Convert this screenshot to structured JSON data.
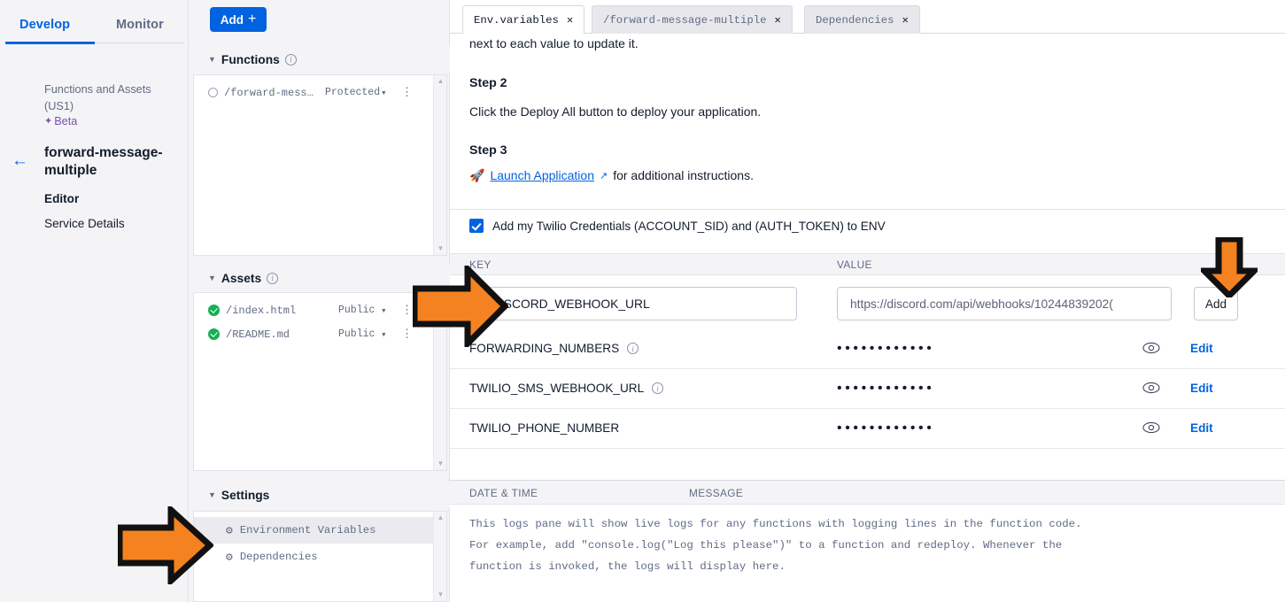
{
  "leftnav": {
    "tabs": [
      {
        "label": "Develop",
        "active": true
      },
      {
        "label": "Monitor",
        "active": false
      }
    ],
    "subtitle": "Functions and Assets (US1)",
    "beta_label": "Beta",
    "back_icon": "←",
    "service_title": "forward-message-multiple",
    "items": [
      {
        "label": "Editor"
      },
      {
        "label": "Service Details"
      }
    ]
  },
  "explorer": {
    "add_button": "Add",
    "add_plus": "+",
    "functions": {
      "title": "Functions",
      "rows": [
        {
          "name": "/forward-mess…",
          "visibility": "Protected"
        }
      ]
    },
    "assets": {
      "title": "Assets",
      "rows": [
        {
          "name": "/index.html",
          "visibility": "Public"
        },
        {
          "name": "/README.md",
          "visibility": "Public"
        }
      ]
    },
    "settings": {
      "title": "Settings",
      "items": [
        {
          "label": "Environment Variables",
          "selected": true
        },
        {
          "label": "Dependencies",
          "selected": false
        }
      ]
    }
  },
  "main": {
    "tabs": [
      {
        "label": "Env.variables",
        "active": true
      },
      {
        "label": "/forward-message-multiple",
        "active": false
      },
      {
        "label": "Dependencies",
        "active": false
      }
    ],
    "close_glyph": "✕",
    "doc": {
      "line1": "next to each value to update it.",
      "step2_title": "Step 2",
      "step2_body": "Click the Deploy All button to deploy your application.",
      "step3_title": "Step 3",
      "step3_link": "Launch Application",
      "step3_after": "for additional instructions.",
      "rocket_icon": "🚀",
      "external_icon": "↗"
    },
    "credentials_checkbox": {
      "label": "Add my Twilio Credentials (ACCOUNT_SID) and (AUTH_TOKEN) to ENV",
      "checked": true
    },
    "table": {
      "col_key": "KEY",
      "col_value": "VALUE",
      "new_row": {
        "key_value": "DISCORD_WEBHOOK_URL",
        "value_placeholder": "https://discord.com/api/webhooks/10244839202(",
        "add_label": "Add"
      },
      "rows": [
        {
          "key": "FORWARDING_NUMBERS",
          "has_info": true,
          "masked": "••••••••••••",
          "edit_label": "Edit"
        },
        {
          "key": "TWILIO_SMS_WEBHOOK_URL",
          "has_info": true,
          "masked": "••••••••••••",
          "edit_label": "Edit"
        },
        {
          "key": "TWILIO_PHONE_NUMBER",
          "has_info": false,
          "masked": "••••••••••••",
          "edit_label": "Edit"
        }
      ]
    },
    "logs": {
      "col_datetime": "DATE & TIME",
      "col_message": "MESSAGE",
      "body": "This logs pane will show live logs for any functions with logging lines in the function code. For example, add \"console.log(\"Log this please\")\" to a function and redeploy. Whenever the function is invoked, the logs will display here."
    }
  },
  "annotations": {
    "arrow_color": "#F58220",
    "arrow_outline": "#111111",
    "arrows": [
      {
        "name": "arrow-to-key-input",
        "direction": "right"
      },
      {
        "name": "arrow-to-add-button",
        "direction": "down"
      },
      {
        "name": "arrow-to-environment-variables",
        "direction": "right"
      }
    ]
  }
}
